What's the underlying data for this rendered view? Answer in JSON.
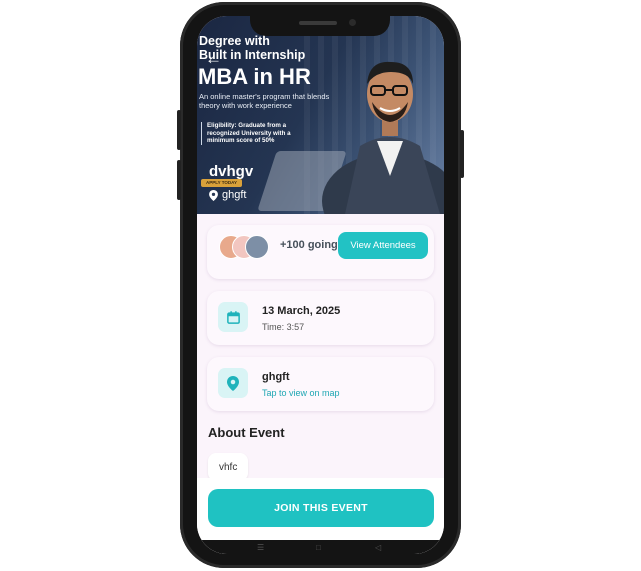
{
  "banner": {
    "line1": "Degree with",
    "line2": "Built in Internship",
    "title": "MBA in HR",
    "subtitle": "An online master's program that blends theory with work experience",
    "eligibility": "Eligibility: Graduate from a recognized University with a minimum score of 50%",
    "apply_label": "APPLY TODAY",
    "back_icon": "arrow-left-icon"
  },
  "event": {
    "name": "dvhgv",
    "location": "ghgft"
  },
  "attendees": {
    "going_text": "+100 going",
    "button_label": "View Attendees",
    "avatar_colors": [
      "#e8a98c",
      "#f2c6c0",
      "#7d8fa6"
    ]
  },
  "date_card": {
    "date": "13 March, 2025",
    "time": "Time: 3:57",
    "icon": "calendar-icon"
  },
  "location_card": {
    "title": "ghgft",
    "link": "Tap to view on map",
    "icon": "map-pin-icon"
  },
  "about": {
    "heading": "About Event",
    "description": "vhfc"
  },
  "cta": {
    "label": "JOIN THIS EVENT"
  },
  "colors": {
    "accent": "#22c2c4",
    "card_bg": "#fdf8fd",
    "page_bg": "#fbf4fb",
    "link": "#1fa7b3"
  }
}
